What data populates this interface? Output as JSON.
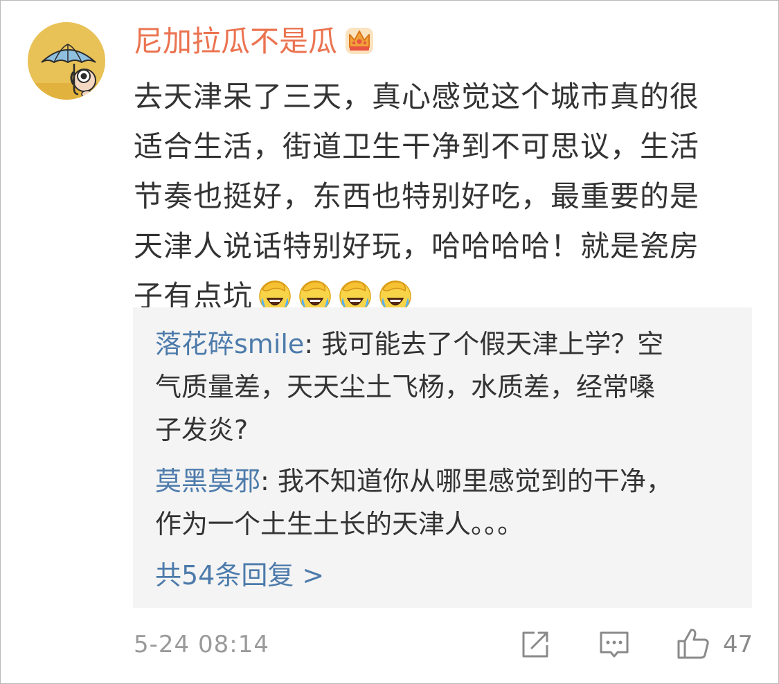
{
  "comment": {
    "username": "尼加拉瓜不是瓜",
    "badge_icon": "crown-badge-icon",
    "content_lines": [
      "去天津呆了三天，真心感觉这个城市真的很",
      "适合生活，街道卫生干净到不可思议，生活",
      "节奏也挺好，东西也特别好吃，最重要的是",
      "天津人说话特别好玩，哈哈哈哈！就是瓷房",
      "子有点坑"
    ],
    "emoji_icon": "laughing-crying-facepalm-emoji",
    "emoji_count": 4
  },
  "replies": {
    "items": [
      {
        "name": "落花碎smile",
        "line1": ": 我可能去了个假天津上学？空",
        "line2": "气质量差，天天尘土飞杨，水质差，经常嗓",
        "line3": "子发炎?"
      },
      {
        "name": "莫黑莫邪",
        "line1": ": 我不知道你从哪里感觉到的干净，",
        "line2": "作为一个土生土长的天津人。。。"
      }
    ],
    "more_label": "共54条回复 >"
  },
  "footer": {
    "timestamp": "5-24 08:14",
    "like_count": "47"
  },
  "colors": {
    "username": "#eb7350",
    "link": "#4d7bab",
    "text": "#333333",
    "reply_bg": "#f4f4f4",
    "meta": "#9a9a9a"
  }
}
